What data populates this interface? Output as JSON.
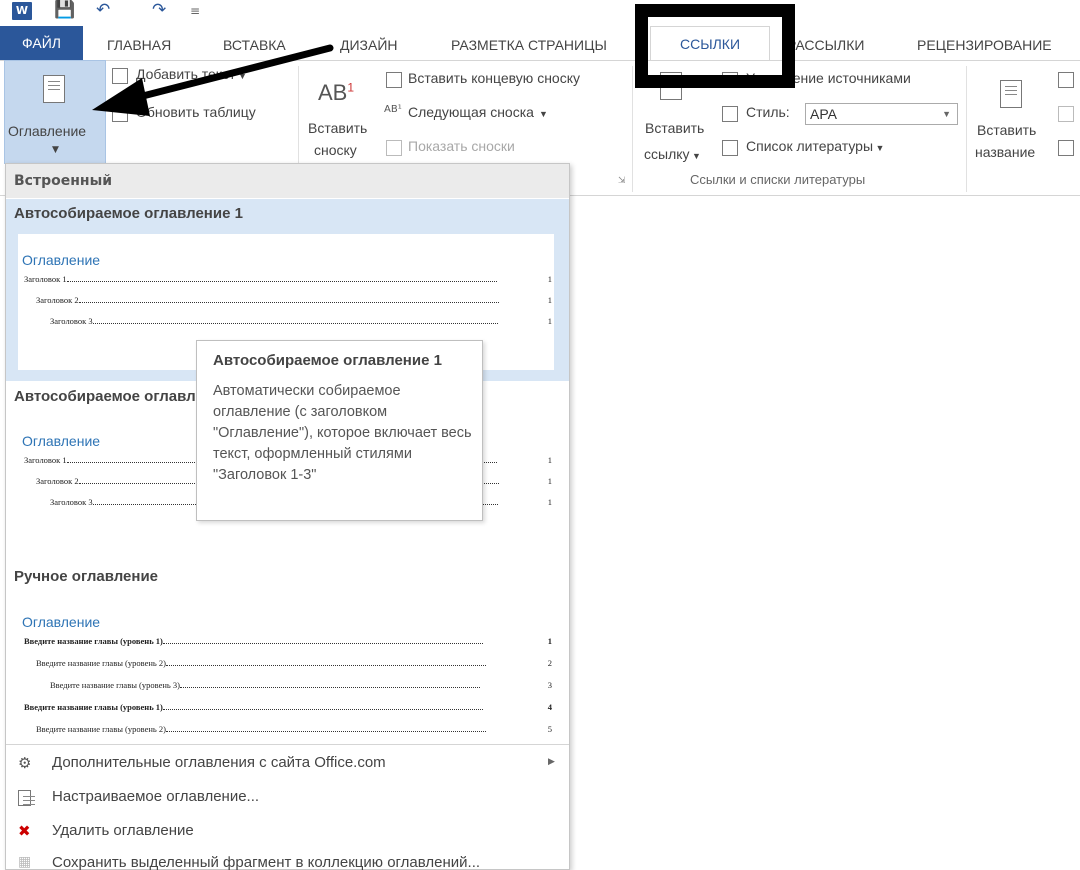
{
  "tabs": [
    "ФАЙЛ",
    "ГЛАВНАЯ",
    "ВСТАВКА",
    "ДИЗАЙН",
    "РАЗМЕТКА СТРАНИЦЫ",
    "ССЫЛКИ",
    "РАССЫЛКИ",
    "РЕЦЕНЗИРОВАНИЕ"
  ],
  "ribbon": {
    "toc_label": "Оглавление",
    "add_text": "Добавить текст",
    "update_table": "Обновить таблицу",
    "insert_footnote_1": "Вставить",
    "insert_footnote_2": "сноску",
    "insert_endnote": "Вставить концевую сноску",
    "next_footnote": "Следующая сноска",
    "show_notes": "Показать сноски",
    "insert_citation_1": "Вставить",
    "insert_citation_2": "ссылку",
    "manage_sources": "Управление источниками",
    "style_label": "Стиль:",
    "style_value": "APA",
    "bibliography": "Список литературы",
    "group_citations": "Ссылки и списки литературы",
    "insert_caption_1": "Вставить",
    "insert_caption_2": "название"
  },
  "dropdown": {
    "header": "Встроенный",
    "gallery": [
      {
        "title": "Автособираемое оглавление 1",
        "preview_head": "Оглавление",
        "lines": [
          {
            "text": "Заголовок 1",
            "page": "1"
          },
          {
            "text": "Заголовок 2",
            "page": "1"
          },
          {
            "text": "Заголовок 3",
            "page": "1"
          }
        ]
      },
      {
        "title": "Автособираемое оглавление 2",
        "preview_head": "Оглавление",
        "lines": [
          {
            "text": "Заголовок 1",
            "page": "1"
          },
          {
            "text": "Заголовок 2",
            "page": "1"
          },
          {
            "text": "Заголовок 3",
            "page": "1"
          }
        ]
      },
      {
        "title": "Ручное оглавление",
        "preview_head": "Оглавление",
        "lines": [
          {
            "text": "Введите название главы (уровень 1)",
            "page": "1"
          },
          {
            "text": "Введите название главы (уровень 2)",
            "page": "2"
          },
          {
            "text": "Введите название главы (уровень 3)",
            "page": "3"
          },
          {
            "text": "Введите название главы (уровень 1)",
            "page": "4"
          },
          {
            "text": "Введите название главы (уровень 2)",
            "page": "5"
          }
        ]
      }
    ],
    "menu": [
      "Дополнительные оглавления с сайта Office.com",
      "Настраиваемое оглавление...",
      "Удалить оглавление",
      "Сохранить выделенный фрагмент в коллекцию оглавлений..."
    ]
  },
  "tooltip": {
    "title": "Автособираемое оглавление 1",
    "body": "Автоматически собираемое оглавление (с заголовком \"Оглавление\"), которое включает весь текст, оформленный стилями \"Заголовок 1-3\""
  },
  "colors": {
    "brand": "#2b579a",
    "selection": "#d8e6f5",
    "heading_blue": "#2e74b5"
  }
}
